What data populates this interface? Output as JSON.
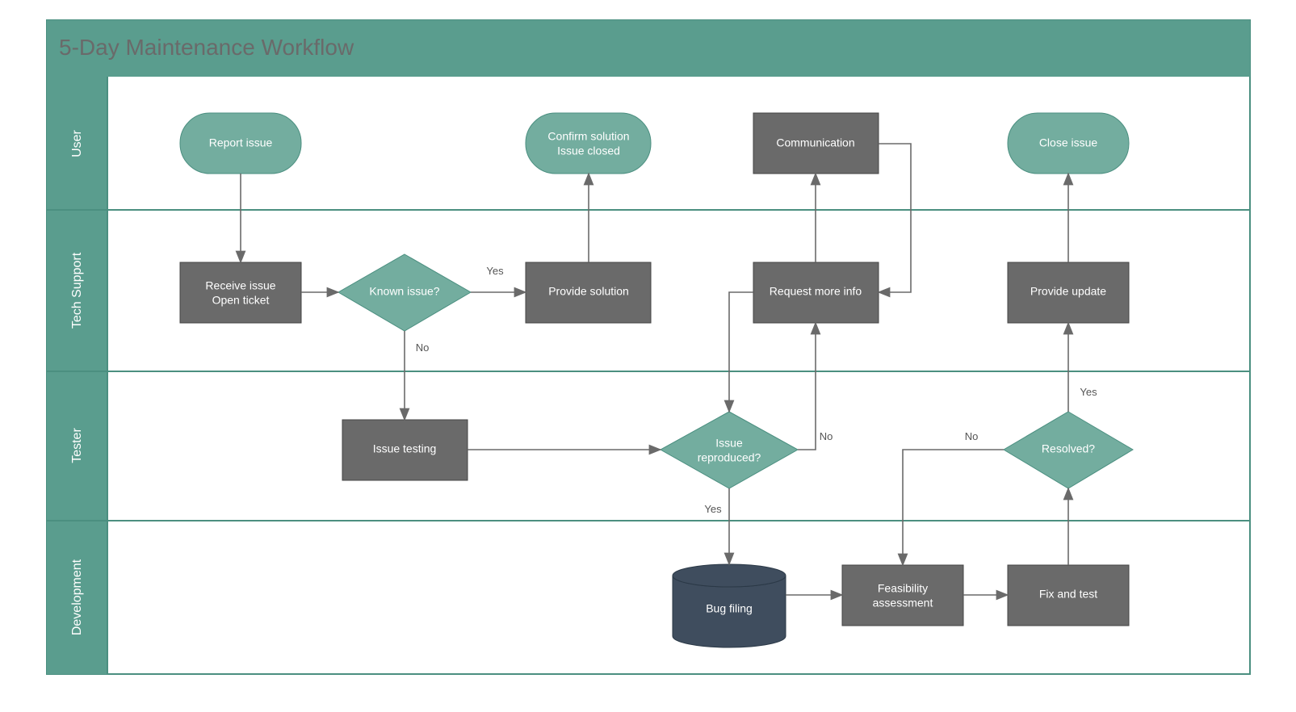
{
  "title": "5-Day Maintenance Workflow",
  "lanes": [
    "User",
    "Tech Support",
    "Tester",
    "Development"
  ],
  "nodes": {
    "report": {
      "label": "Report issue"
    },
    "confirm1": {
      "line1": "Confirm solution",
      "line2": "Issue closed"
    },
    "communication": {
      "label": "Communication"
    },
    "close": {
      "label": "Close issue"
    },
    "receive": {
      "line1": "Receive issue",
      "line2": "Open ticket"
    },
    "known": {
      "label": "Known issue?"
    },
    "provide": {
      "label": "Provide solution"
    },
    "reqinfo": {
      "label": "Request more info"
    },
    "update": {
      "label": "Provide update"
    },
    "testing": {
      "label": "Issue testing"
    },
    "reproduced": {
      "line1": "Issue",
      "line2": "reproduced?"
    },
    "resolved": {
      "label": "Resolved?"
    },
    "bugfiling": {
      "label": "Bug filing"
    },
    "feasibility": {
      "line1": "Feasibility",
      "line2": "assessment"
    },
    "fixtest": {
      "label": "Fix and test"
    }
  },
  "edgeLabels": {
    "knownYes": "Yes",
    "knownNo": "No",
    "reproNo": "No",
    "reproYes": "Yes",
    "resolvedNo": "No",
    "resolvedYes": "Yes"
  }
}
